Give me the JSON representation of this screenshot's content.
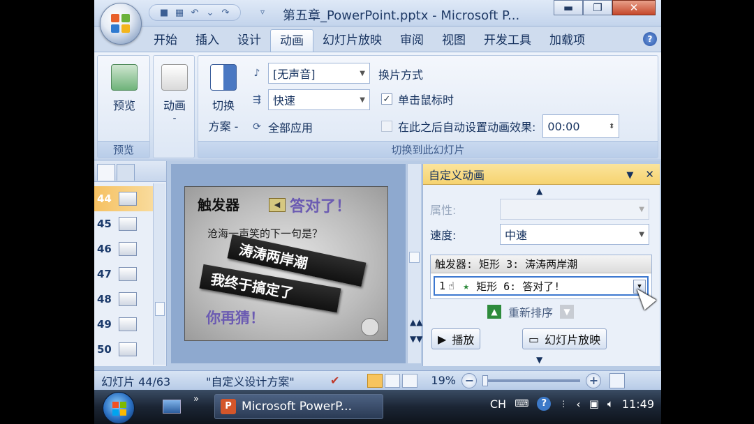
{
  "window": {
    "title": "第五章_PowerPoint.pptx - Microsoft P...",
    "minimize": "▬",
    "restore": "❐",
    "close": "✕"
  },
  "tabs": [
    "开始",
    "插入",
    "设计",
    "动画",
    "幻灯片放映",
    "审阅",
    "视图",
    "开发工具",
    "加载项"
  ],
  "active_tab": "动画",
  "help": "?",
  "ribbon": {
    "preview_group": {
      "button": "预览",
      "label": "预览"
    },
    "animation_group": {
      "button": "动画",
      "dash": "-"
    },
    "transition_group": {
      "scheme_line1": "切换",
      "scheme_line2": "方案 -",
      "sound_value": "[无声音]",
      "speed_value": "快速",
      "apply_all": "全部应用",
      "advance_title": "换片方式",
      "on_click": "单击鼠标时",
      "on_click_checked": true,
      "auto_after": "在此之后自动设置动画效果:",
      "auto_after_time": "00:00",
      "label": "切换到此幻灯片"
    }
  },
  "slides_panel": {
    "items": [
      {
        "num": "44",
        "active": true
      },
      {
        "num": "45",
        "active": false
      },
      {
        "num": "46",
        "active": false
      },
      {
        "num": "47",
        "active": false
      },
      {
        "num": "48",
        "active": false
      },
      {
        "num": "49",
        "active": false
      },
      {
        "num": "50",
        "active": false
      }
    ]
  },
  "slide": {
    "title": "触发器",
    "correct": "答对了！",
    "question": "沧海一声笑的下一句是？",
    "answer1": "涛涛两岸潮",
    "answer2": "我终于搞定了",
    "guess": "你再猜！"
  },
  "custom_animation": {
    "title": "自定义动画",
    "property_label": "属性:",
    "speed_label": "速度:",
    "speed_value": "中速",
    "trigger": "触发器: 矩形 3: 涛涛两岸潮",
    "effect_index": "1",
    "effect": "矩形 6: 答对了!",
    "reorder": "重新排序",
    "play": "播放",
    "slideshow": "幻灯片放映"
  },
  "status": {
    "slide_info": "幻灯片 44/63",
    "theme": "\"自定义设计方案\"",
    "zoom": "19%",
    "zoom_fraction": 0.0
  },
  "taskbar": {
    "app": "Microsoft PowerP...",
    "language": "CH",
    "time": "11:49"
  }
}
